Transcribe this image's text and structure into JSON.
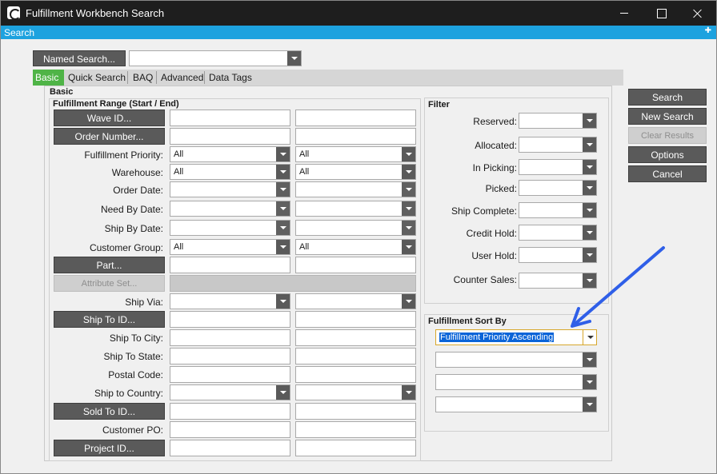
{
  "window": {
    "title": "Fulfillment Workbench Search",
    "app_icon": "epicor-e-icon"
  },
  "panel": {
    "title": "Search"
  },
  "named_search": {
    "button": "Named Search...",
    "value": ""
  },
  "tabs": [
    {
      "label": "Basic",
      "active": true
    },
    {
      "label": "Quick Search",
      "active": false
    },
    {
      "label": "BAQ",
      "active": false
    },
    {
      "label": "Advanced",
      "active": false
    },
    {
      "label": "Data Tags",
      "active": false
    }
  ],
  "basic": {
    "section_title": "Basic",
    "range_title": "Fulfillment Range (Start / End)",
    "wave_id": "Wave ID...",
    "order_number": "Order Number...",
    "fulfillment_priority": {
      "label": "Fulfillment Priority:",
      "start": "All",
      "end": "All"
    },
    "warehouse": {
      "label": "Warehouse:",
      "start": "All",
      "end": "All"
    },
    "order_date": "Order Date:",
    "need_by_date": "Need By Date:",
    "ship_by_date": "Ship By Date:",
    "customer_group": {
      "label": "Customer Group:",
      "start": "All",
      "end": "All"
    },
    "part": "Part...",
    "attribute_set": "Attribute Set...",
    "ship_via": "Ship Via:",
    "ship_to_id": "Ship To ID...",
    "ship_to_city": "Ship To City:",
    "ship_to_state": "Ship To State:",
    "postal_code": "Postal Code:",
    "ship_to_country": "Ship to Country:",
    "sold_to_id": "Sold To ID...",
    "customer_po": "Customer PO:",
    "project_id": "Project ID..."
  },
  "filter": {
    "title": "Filter",
    "reserved": "Reserved:",
    "allocated": "Allocated:",
    "in_picking": "In Picking:",
    "picked": "Picked:",
    "ship_complete": "Ship Complete:",
    "credit_hold": "Credit Hold:",
    "user_hold": "User Hold:",
    "counter_sales": "Counter Sales:"
  },
  "sort": {
    "title": "Fulfillment Sort By",
    "sort1": "Fulfillment Priority Ascending",
    "sort2": "",
    "sort3": "",
    "sort4": ""
  },
  "actions": {
    "search": "Search",
    "new_search": "New Search",
    "clear_results": "Clear Results",
    "options": "Options",
    "cancel": "Cancel"
  },
  "annotation": {
    "arrow_color": "#2f5fe8"
  },
  "colors": {
    "accent": "#1da2df",
    "active_tab": "#4fb447",
    "button": "#5a5a5a"
  }
}
